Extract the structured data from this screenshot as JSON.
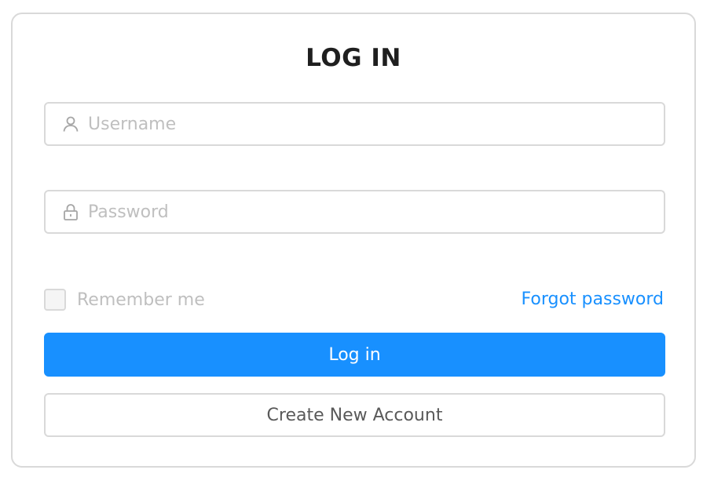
{
  "form": {
    "title": "LOG IN",
    "username": {
      "placeholder": "Username",
      "value": "",
      "icon": "user-icon"
    },
    "password": {
      "placeholder": "Password",
      "value": "",
      "icon": "lock-icon"
    },
    "remember": {
      "label": "Remember me",
      "checked": false
    },
    "forgot_label": "Forgot password",
    "login_label": "Log in",
    "create_label": "Create New Account"
  },
  "colors": {
    "primary": "#1890ff",
    "border": "#d9d9d9",
    "placeholder": "#bfbfbf",
    "title": "#1f1f1f"
  }
}
